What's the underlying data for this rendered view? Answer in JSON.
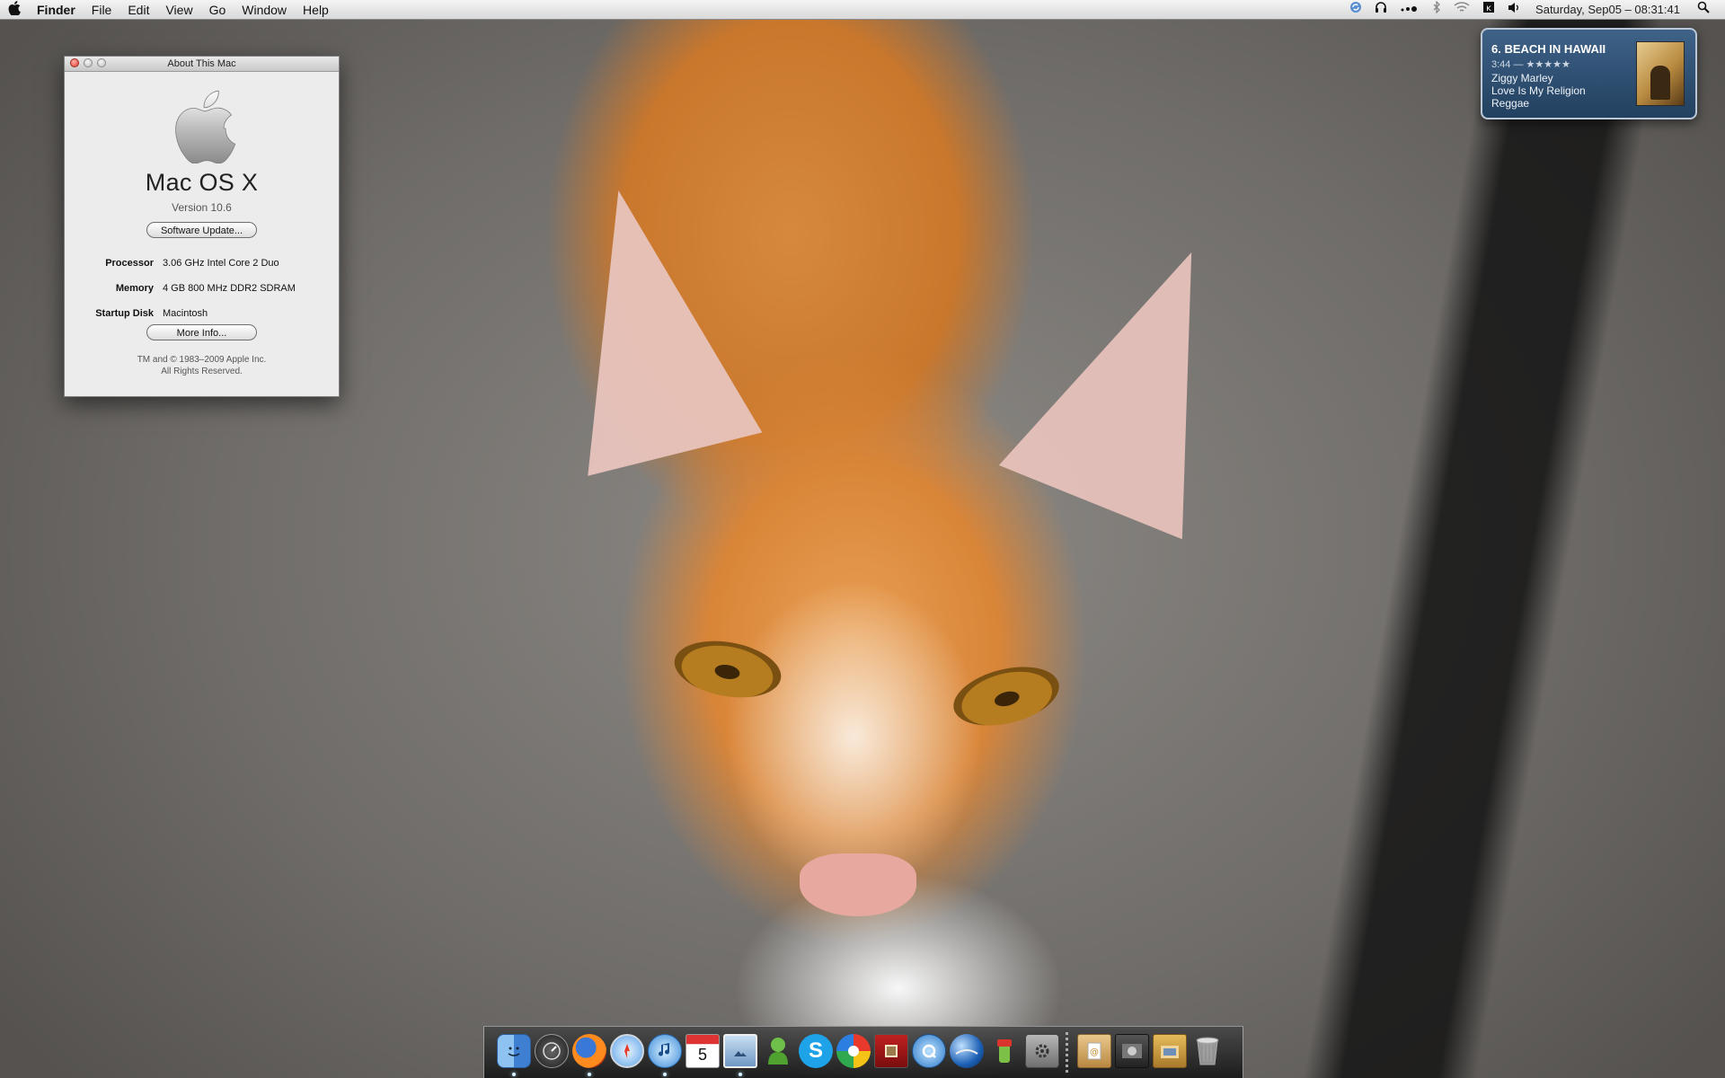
{
  "menubar": {
    "apple_icon": "apple-logo-icon",
    "app_name": "Finder",
    "menus": [
      "File",
      "Edit",
      "View",
      "Go",
      "Window",
      "Help"
    ],
    "status_icons": [
      "sync-icon",
      "headphones-icon",
      "dots-icon",
      "bluetooth-icon",
      "wifi-icon",
      "input-menu-icon",
      "volume-icon"
    ],
    "clock": "Saturday, Sep05 – 08:31:41",
    "spotlight_icon": "search-icon"
  },
  "about_window": {
    "title": "About This Mac",
    "os_name": "Mac OS X",
    "version": "Version 10.6",
    "software_update_label": "Software Update...",
    "specs": [
      {
        "label": "Processor",
        "value": "3.06 GHz Intel Core 2 Duo"
      },
      {
        "label": "Memory",
        "value": "4 GB 800 MHz DDR2 SDRAM"
      },
      {
        "label": "Startup Disk",
        "value": "Macintosh"
      }
    ],
    "more_info_label": "More Info...",
    "legal_line1": "TM and © 1983–2009 Apple Inc.",
    "legal_line2": "All Rights Reserved."
  },
  "now_playing": {
    "track": "6. BEACH IN HAWAII",
    "time_rating": "3:44 — ★★★★★",
    "artist": "Ziggy Marley",
    "album": "Love Is My Religion",
    "genre": "Reggae"
  },
  "dock": {
    "apps": [
      "finder-icon",
      "dashboard-icon",
      "firefox-icon",
      "safari-icon",
      "itunes-icon",
      "ical-icon",
      "preview-icon",
      "adium-icon",
      "skype-icon",
      "picasa-icon",
      "photo-booth-icon",
      "quicktime-icon",
      "google-earth-icon",
      "transmission-icon",
      "system-preferences-icon"
    ],
    "ical_day": "5",
    "stacks": [
      "documents-stack-icon",
      "downloads-stack-icon",
      "applications-stack-icon",
      "trash-icon"
    ]
  },
  "colors": {
    "menubar_bg": "#e6e6e6",
    "widget_bg": "#2e4d70",
    "close_button": "#e0372b"
  }
}
